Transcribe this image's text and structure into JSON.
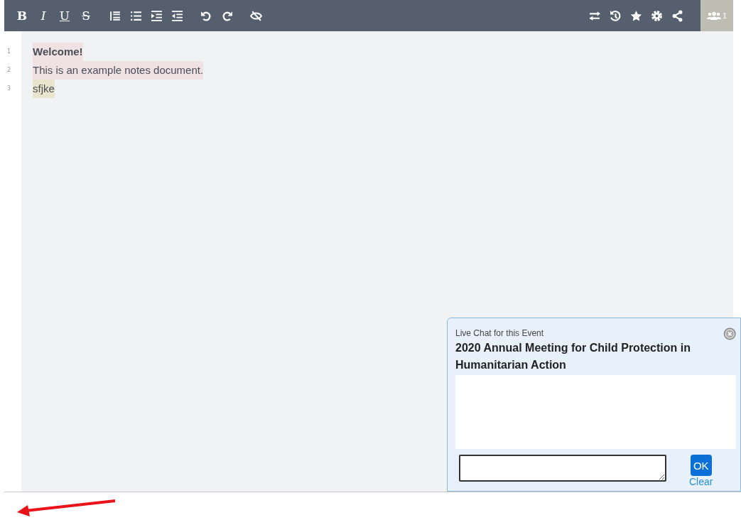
{
  "toolbar": {
    "format_buttons": [
      {
        "label": "B",
        "kind": "bold"
      },
      {
        "label": "I",
        "kind": "italic"
      },
      {
        "label": "U",
        "kind": "underline"
      },
      {
        "label": "S",
        "kind": "strike"
      }
    ],
    "user_count": "1"
  },
  "lines": [
    {
      "number": "1",
      "text": "Welcome!",
      "bold": true,
      "color": "#f0e1e2"
    },
    {
      "number": "2",
      "text": "This is an example notes document.",
      "bold": false,
      "color": "#f0e1e2"
    },
    {
      "number": "3",
      "text": "sfjke",
      "bold": false,
      "color": "#e9e4cc"
    }
  ],
  "chat": {
    "subtitle": "Live Chat for this Event",
    "title": "2020 Annual Meeting for Child Protection in Humanitarian Action",
    "ok_button": "OK",
    "clear_link": "Clear"
  }
}
